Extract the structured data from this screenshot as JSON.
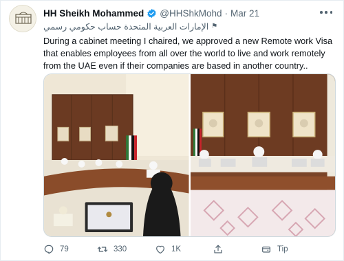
{
  "tweet": {
    "display_name": "HH Sheikh Mohammed",
    "handle": "@HHShkMohd",
    "separator": "·",
    "date": "Mar 21",
    "subline": "الإمارات العربية المتحدة حساب حكومي رسمي",
    "text": "During a cabinet meeting I chaired, we approved a new Remote work Visa that enables employees from all over the world to live and work remotely from the UAE even if their companies are based in another country..",
    "reply_count": "79",
    "retweet_count": "330",
    "like_count": "1K",
    "tip_label": "Tip"
  },
  "icons": {
    "verified": "verified-badge-icon",
    "more": "more-options-icon",
    "flag": "government-flag-icon",
    "reply": "reply-icon",
    "retweet": "retweet-icon",
    "like": "heart-icon",
    "tip": "tip-icon"
  },
  "colors": {
    "verified_blue": "#1d9bf0",
    "secondary_text": "#536471",
    "border": "#cfd9de"
  }
}
